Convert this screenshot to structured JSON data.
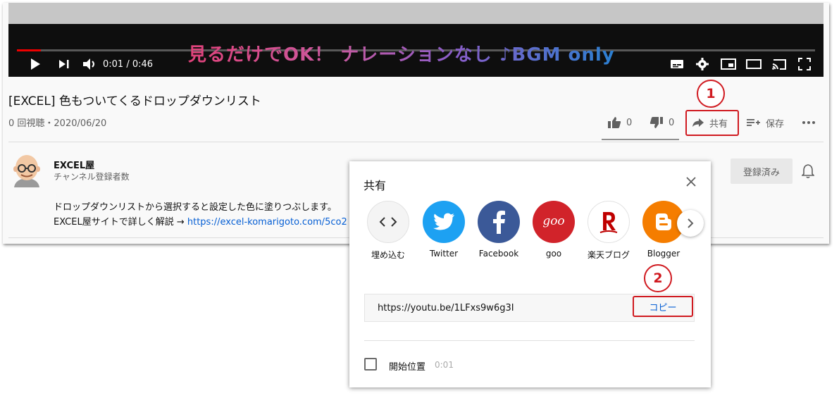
{
  "player": {
    "caption": "見るだけでOK！ ナレーションなし ♪BGM only",
    "time": "0:01 / 0:46",
    "progress_fraction": 0.03
  },
  "video": {
    "title": "[EXCEL] 色もついてくるドロップダウンリスト",
    "meta": "0 回視聴・2020/06/20"
  },
  "actions": {
    "like_count": "0",
    "dislike_count": "0",
    "share_label": "共有",
    "save_label": "保存"
  },
  "annotations": {
    "step1": "1",
    "step2": "2",
    "accent": "#d01a20"
  },
  "channel": {
    "name": "EXCEL屋",
    "subscribers": "チャンネル登録者数",
    "subscribed_label": "登録済み"
  },
  "description": {
    "line1": "ドロップダウンリストから選択すると設定した色に塗りつぶします。",
    "line2_prefix": "EXCEL屋サイトで詳しく解説 → ",
    "line2_link": "https://excel-komarigoto.com/5co2"
  },
  "share_dialog": {
    "title": "共有",
    "targets": [
      {
        "label": "埋め込む",
        "icon": "embed-icon",
        "color": "#f4f4f4"
      },
      {
        "label": "Twitter",
        "icon": "twitter-icon",
        "color": "#1da1f2"
      },
      {
        "label": "Facebook",
        "icon": "facebook-icon",
        "color": "#3b5998"
      },
      {
        "label": "goo",
        "icon": "goo-icon",
        "color": "#d1232a"
      },
      {
        "label": "楽天ブログ",
        "icon": "rakuten-icon",
        "color": "#ffffff"
      },
      {
        "label": "Blogger",
        "icon": "blogger-icon",
        "color": "#f57d00"
      }
    ],
    "url": "https://youtu.be/1LFxs9w6g3I",
    "copy_label": "コピー",
    "start_at_label": "開始位置",
    "start_at_value": "0:01"
  }
}
